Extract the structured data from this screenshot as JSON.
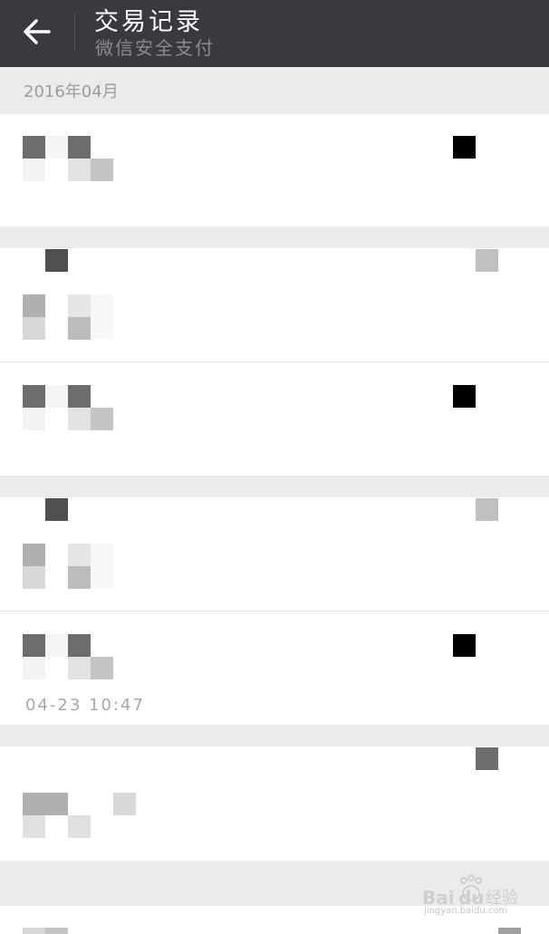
{
  "header": {
    "title": "交易记录",
    "subtitle": "微信安全支付"
  },
  "month_label": "2016年04月",
  "records": [
    {
      "kind": "expense",
      "amount_masked": true
    },
    {
      "kind": "income",
      "amount_masked": true
    },
    {
      "kind": "expense",
      "amount_masked": true
    },
    {
      "kind": "income",
      "amount_masked": true
    },
    {
      "kind": "expense",
      "amount_masked": true,
      "time_partial": "04-23 10:47"
    },
    {
      "kind": "income",
      "amount_masked": true
    },
    {
      "kind": "income",
      "amount_masked": true
    }
  ],
  "watermark": {
    "logo_text": "Baidu经验",
    "url": "jingyan.baidu.com"
  },
  "colors": {
    "header_bg": "#393a3f",
    "band_bg": "#ebebeb",
    "mosaic_dark": "#6d6d6d",
    "mosaic_light": "#e3e3e3"
  }
}
